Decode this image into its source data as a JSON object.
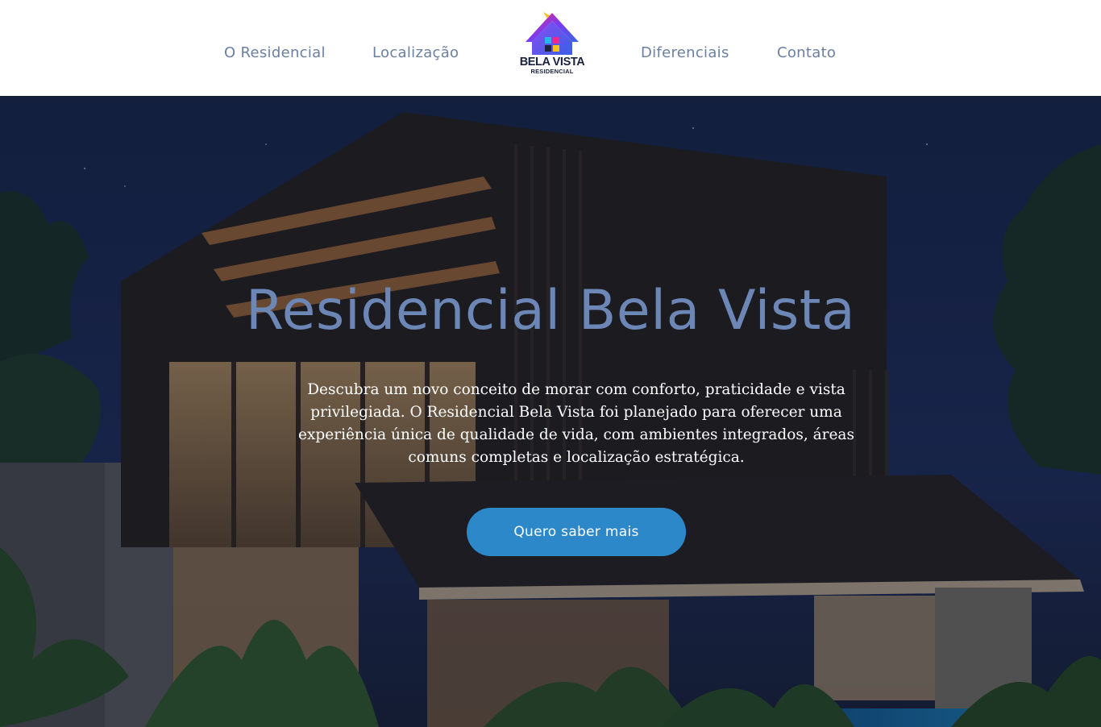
{
  "header": {
    "nav": [
      {
        "label": "O Residencial"
      },
      {
        "label": "Localização"
      },
      {
        "label": "Diferenciais"
      },
      {
        "label": "Contato"
      }
    ],
    "logo": {
      "name": "BELA VISTA",
      "subtitle": "RESIDENCIAL",
      "colors": {
        "roof_left": "#f0247e",
        "roof_mid": "#7a3cf0",
        "roof_right": "#3a64e6",
        "window_cyan": "#22b8e8",
        "window_pink": "#ec2a8c",
        "window_yellow": "#f5c31c",
        "window_dark": "#1b2340"
      }
    }
  },
  "hero": {
    "title": "Residencial Bela Vista",
    "description": "Descubra um novo conceito de morar com conforto, praticidade e vista privilegiada. O Residencial Bela Vista foi planejado para oferecer uma experiência única de qualidade de vida, com ambientes integrados, áreas comuns completas e localização estratégica.",
    "cta_label": "Quero saber mais",
    "colors": {
      "title": "#6c86b6",
      "cta_background": "#2d88c9",
      "overlay": "#0c1222"
    }
  }
}
